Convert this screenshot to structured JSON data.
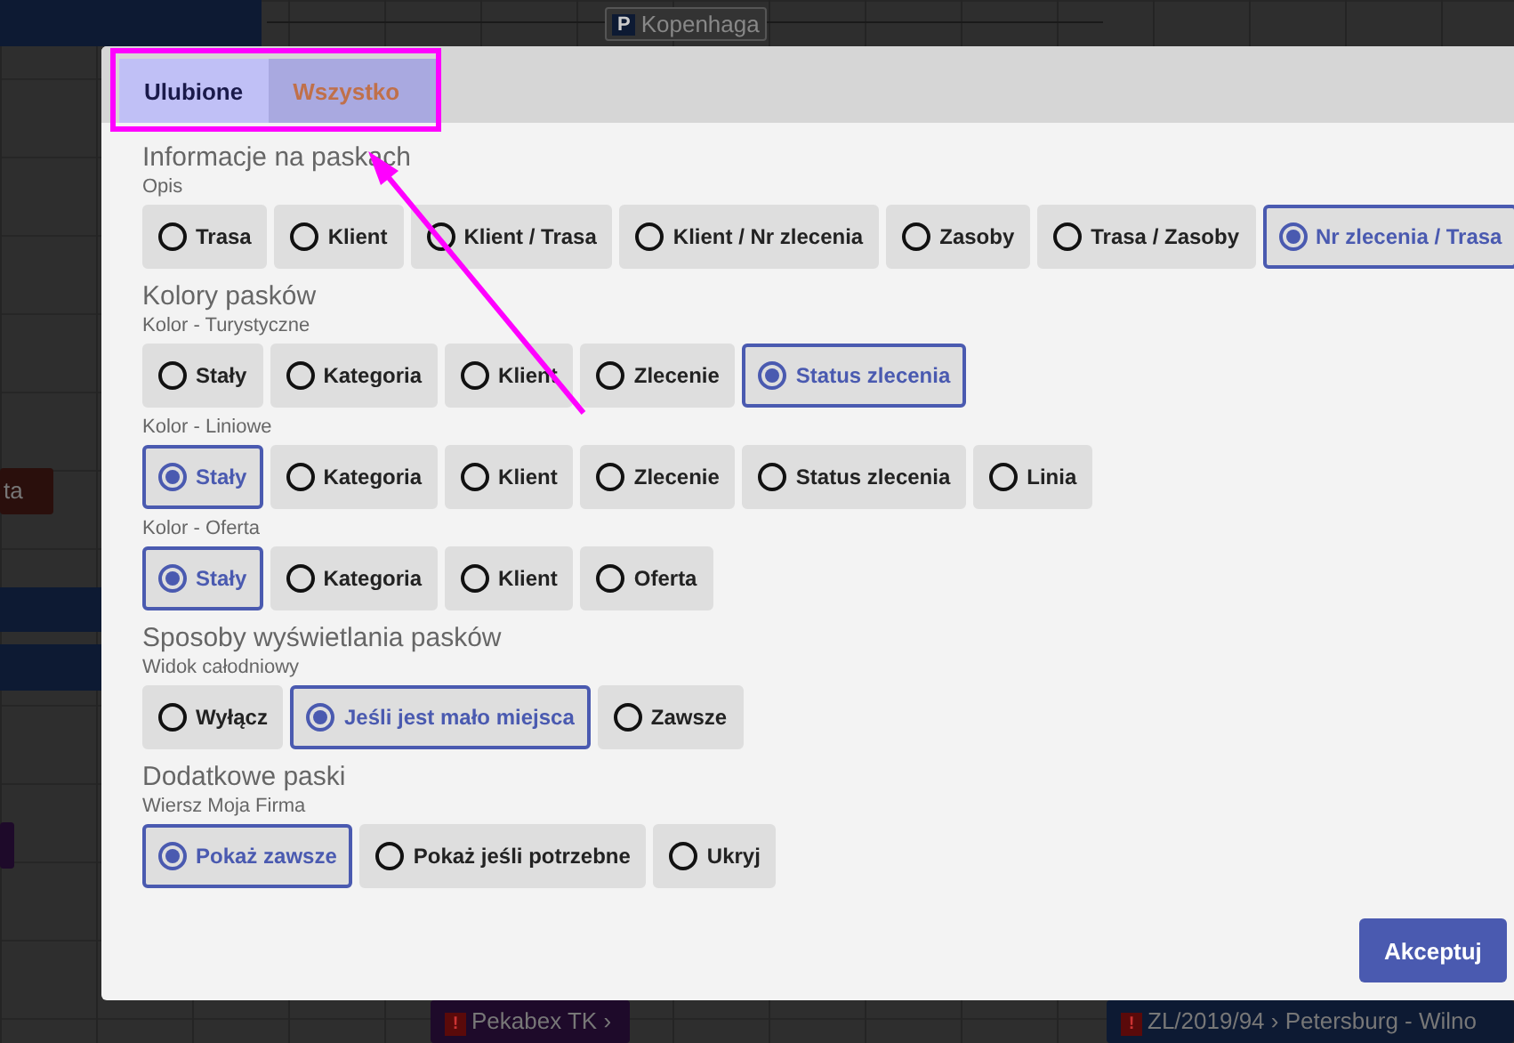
{
  "background": {
    "bars": [
      {
        "label": "Kopenhaga",
        "kind": "place",
        "icon": "P"
      },
      {
        "label": "ta",
        "kind": "bar"
      },
      {
        "kind": "stub"
      },
      {
        "label": "Pekabex TK ›",
        "kind": "alert",
        "icon": "!"
      },
      {
        "label": "ZL/2019/94 › Petersburg - Wilno",
        "kind": "alert",
        "icon": "!"
      }
    ]
  },
  "tabs": [
    {
      "label": "Ulubione",
      "selected": true
    },
    {
      "label": "Wszystko",
      "selected": false
    }
  ],
  "sections": [
    {
      "title": "Informacje na paskach",
      "groups": [
        {
          "label": "Opis",
          "options": [
            {
              "label": "Trasa",
              "selected": false
            },
            {
              "label": "Klient",
              "selected": false
            },
            {
              "label": "Klient / Trasa",
              "selected": false
            },
            {
              "label": "Klient / Nr zlecenia",
              "selected": false
            },
            {
              "label": "Zasoby",
              "selected": false
            },
            {
              "label": "Trasa / Zasoby",
              "selected": false
            },
            {
              "label": "Nr zlecenia / Trasa",
              "selected": true
            }
          ]
        }
      ]
    },
    {
      "title": "Kolory pasków",
      "groups": [
        {
          "label": "Kolor - Turystyczne",
          "options": [
            {
              "label": "Stały",
              "selected": false
            },
            {
              "label": "Kategoria",
              "selected": false
            },
            {
              "label": "Klient",
              "selected": false
            },
            {
              "label": "Zlecenie",
              "selected": false
            },
            {
              "label": "Status zlecenia",
              "selected": true
            }
          ]
        },
        {
          "label": "Kolor - Liniowe",
          "options": [
            {
              "label": "Stały",
              "selected": true
            },
            {
              "label": "Kategoria",
              "selected": false
            },
            {
              "label": "Klient",
              "selected": false
            },
            {
              "label": "Zlecenie",
              "selected": false
            },
            {
              "label": "Status zlecenia",
              "selected": false
            },
            {
              "label": "Linia",
              "selected": false
            }
          ]
        },
        {
          "label": "Kolor - Oferta",
          "options": [
            {
              "label": "Stały",
              "selected": true
            },
            {
              "label": "Kategoria",
              "selected": false
            },
            {
              "label": "Klient",
              "selected": false
            },
            {
              "label": "Oferta",
              "selected": false
            }
          ]
        }
      ]
    },
    {
      "title": "Sposoby wyświetlania pasków",
      "groups": [
        {
          "label": "Widok całodniowy",
          "options": [
            {
              "label": "Wyłącz",
              "selected": false
            },
            {
              "label": "Jeśli jest mało miejsca",
              "selected": true
            },
            {
              "label": "Zawsze",
              "selected": false
            }
          ]
        }
      ]
    },
    {
      "title": "Dodatkowe paski",
      "groups": [
        {
          "label": "Wiersz Moja Firma",
          "options": [
            {
              "label": "Pokaż zawsze",
              "selected": true
            },
            {
              "label": "Pokaż jeśli potrzebne",
              "selected": false
            },
            {
              "label": "Ukryj",
              "selected": false
            }
          ]
        }
      ]
    }
  ],
  "buttons": [
    "Akceptuj"
  ]
}
